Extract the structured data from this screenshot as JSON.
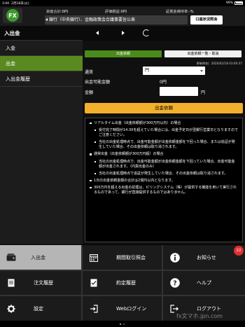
{
  "status_bar": {
    "time": "3:00",
    "date": "2月18日(火)",
    "battery": "99%"
  },
  "header": {
    "logo_text": "FX",
    "assets_label": "資産合計:",
    "assets_value": "0円",
    "pnl_label": "評価損益:",
    "pnl_value": "0円",
    "margin_label": "証拠金維持率:",
    "margin_value": "-%",
    "ticker": "銀行（中央銀行）、金融政策会合議事要旨公表",
    "account_button": "口座状況照会"
  },
  "sidebar": {
    "title": "入出金",
    "items": [
      {
        "label": "入金"
      },
      {
        "label": "出金"
      },
      {
        "label": "入出金履歴"
      }
    ]
  },
  "content": {
    "tabs": {
      "request": "出金依頼",
      "history": "出金依頼一覧・取消"
    },
    "timestamp": "更新時刻：2020/02/18 03:00:37",
    "currency_label": "通貨",
    "currency_value": "円",
    "available_label": "出金可能金額",
    "available_value": "0円",
    "amount_label": "金額",
    "amount_unit": "円",
    "submit_button": "出金依頼",
    "notice": {
      "item1": "リアルタイム出金（出金依頼額が300万円以内）の場合",
      "item1_sub1": "受付完了時間が14:30を超えていた場合には、出金予定日が翌銀行営業日となりますのでご注意ください。",
      "item1_sub2": "当社の出金処理時点で、出金可能金額が出金依頼金額を下回った場合、または追証が発生していた場合、その出金依頼は取り消されます。",
      "item2": "通常出金（出金依頼額が300万円超）の場合",
      "item2_sub1": "当社の出金処理時点で、出金可能金額が出金依頼金額を下回っていた場合、出金可能金額が出金されます。（円貨出金のみ）",
      "item2_sub2": "当社の出金処理時点で追証が発生していた場合、その出金依頼は取り消されます。",
      "item3": "1日の出金依頼金額の合計は2億円以内となります。",
      "item4": "300万円を超える出金の処理は、ピリングシステム（株）が提供する機能を用いて実行されるものであって、銀行が直接提供するものではありません。"
    }
  },
  "menu": {
    "deposit": "入出金",
    "period_report": "期間取引照会",
    "news": "お知らせ",
    "news_badge": "22",
    "order_history": "注文履歴",
    "executed_history": "約定履歴",
    "help": "ヘルプ",
    "settings": "設定",
    "web_login": "Webログイン",
    "logout": "ログアウト"
  },
  "watermark": "fx文マホ.jpn.com",
  "colors": {
    "accent_green": "#5a8a1f",
    "submit_orange": "#f2b02c",
    "badge_red": "#e03030"
  }
}
